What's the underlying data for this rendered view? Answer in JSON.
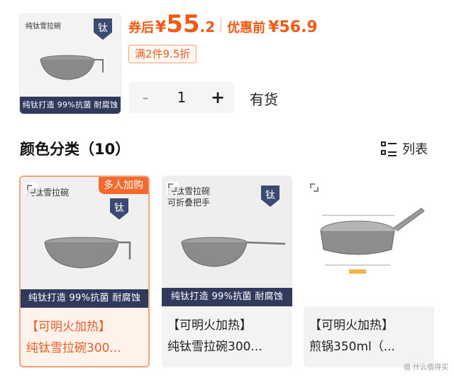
{
  "top": {
    "thumb_title": "纯钛雪拉碗",
    "thumb_strip": "纯钛打造 99%抗菌 耐腐蚀",
    "logo_char": "钛"
  },
  "price": {
    "after_coupon_label": "券后",
    "currency": "¥",
    "integer": "55",
    "decimal": ".2",
    "original_label": "优惠前",
    "original": "¥56.9"
  },
  "promo": "满2件9.5折",
  "stepper": {
    "minus": "-",
    "qty": "1",
    "plus": "+"
  },
  "stock": "有货",
  "section": {
    "title": "颜色分类（10）",
    "toggle_label": "列表"
  },
  "variants": [
    {
      "img_title": "纯钛雪拉碗",
      "img_subtitle": "",
      "strip": "纯钛打造 99%抗菌 耐腐蚀",
      "badge": "多人加购",
      "name_line1": "【可明火加热】",
      "name_line2": "纯钛雪拉碗300...",
      "selected": true
    },
    {
      "img_title": "纯钛雪拉碗",
      "img_subtitle": "可折叠把手",
      "strip": "纯钛打造 99%抗菌 耐腐蚀",
      "badge": "",
      "name_line1": "【可明火加热】",
      "name_line2": "纯钛雪拉碗300...",
      "selected": false
    },
    {
      "img_title": "",
      "img_subtitle": "",
      "strip": "",
      "badge": "",
      "name_line1": "【可明火加热】",
      "name_line2": "煎锅350ml（...",
      "selected": false
    }
  ],
  "watermark": "值 什么值得买",
  "colors": {
    "accent": "#f05a14",
    "strip": "#2f3a5c",
    "logo": "#3a4a72"
  }
}
